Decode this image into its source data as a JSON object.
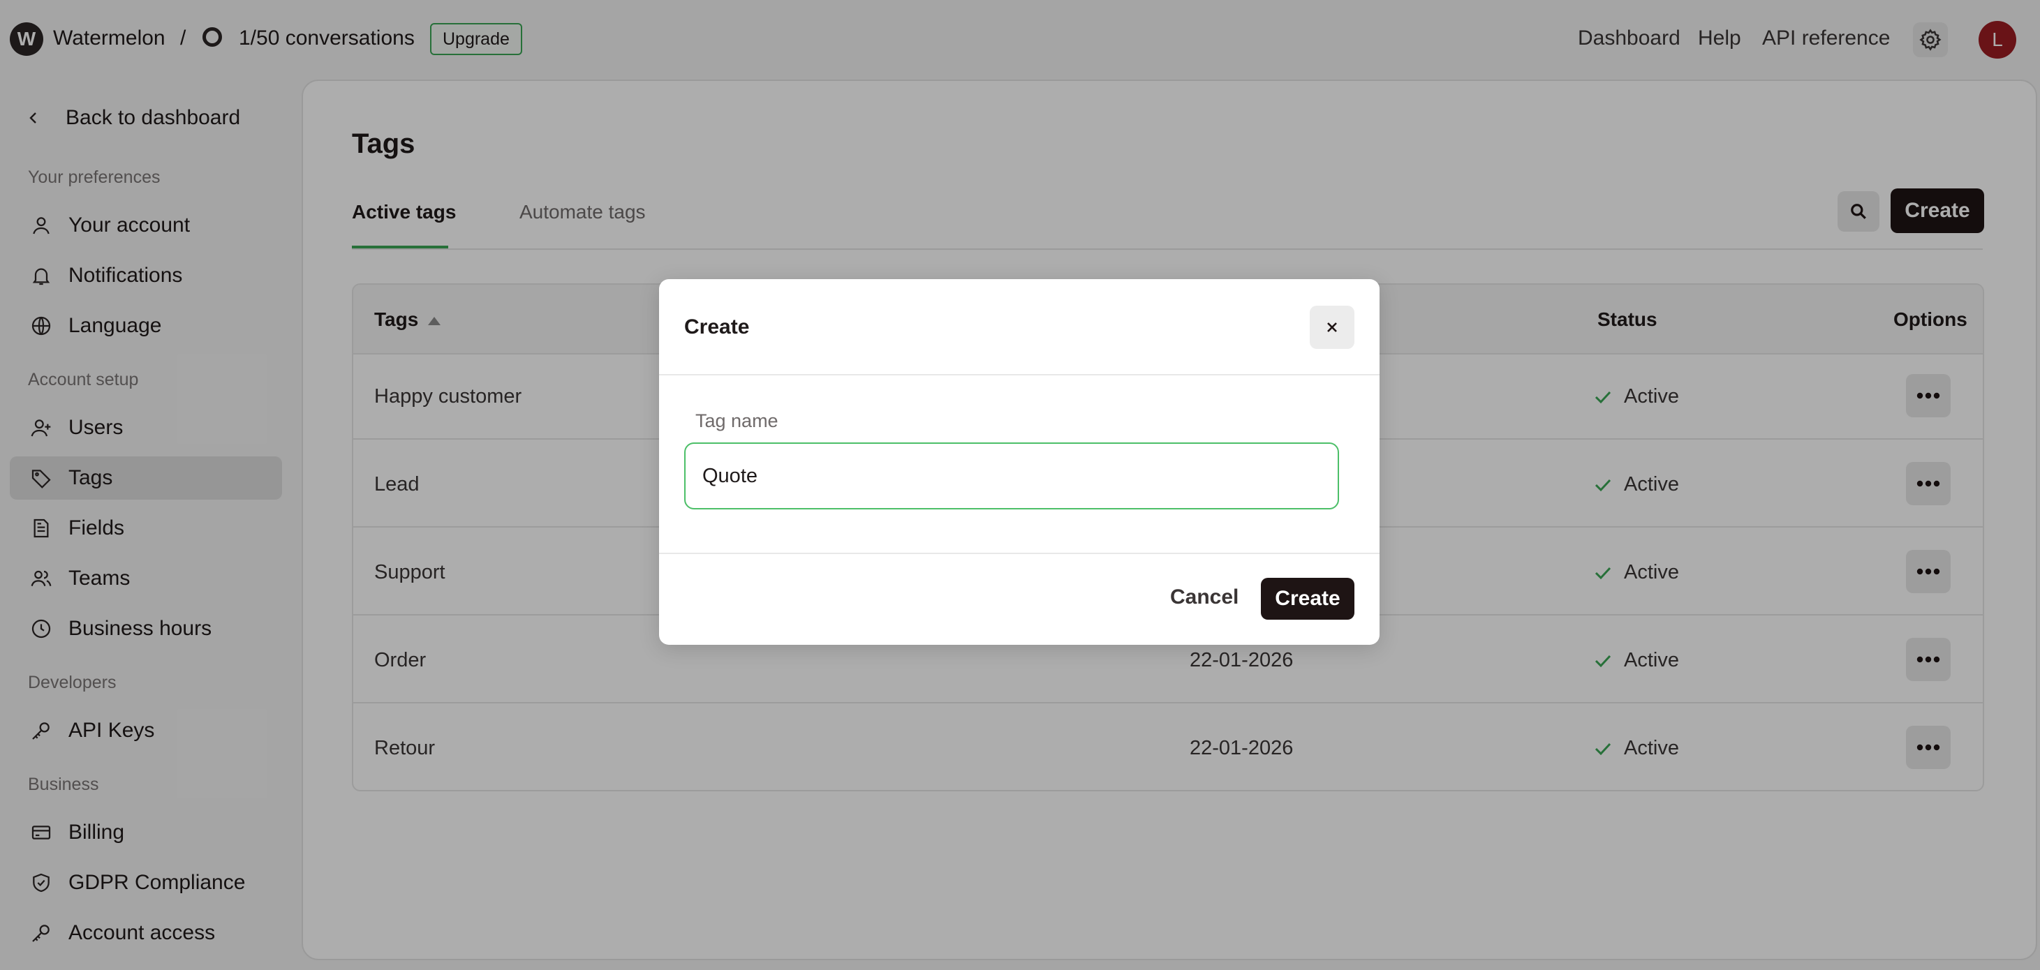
{
  "header": {
    "logo_letter": "W",
    "brand": "Watermelon",
    "separator": "/",
    "conversations": "1/50 conversations",
    "upgrade_label": "Upgrade",
    "links": [
      "Dashboard",
      "Help",
      "API reference"
    ],
    "avatar_initial": "L"
  },
  "sidebar": {
    "back_label": "Back to dashboard",
    "sections": {
      "preferences": "Your preferences",
      "account_setup": "Account setup",
      "developers": "Developers",
      "business": "Business"
    },
    "items": [
      {
        "label": "Your account",
        "icon": "user-icon"
      },
      {
        "label": "Notifications",
        "icon": "bell-icon"
      },
      {
        "label": "Language",
        "icon": "globe-icon"
      },
      {
        "label": "Users",
        "icon": "user-plus-icon"
      },
      {
        "label": "Tags",
        "icon": "tag-icon",
        "active": true
      },
      {
        "label": "Fields",
        "icon": "document-icon"
      },
      {
        "label": "Teams",
        "icon": "users-icon"
      },
      {
        "label": "Business hours",
        "icon": "clock-icon"
      },
      {
        "label": "API Keys",
        "icon": "key-icon"
      },
      {
        "label": "Billing",
        "icon": "credit-card-icon"
      },
      {
        "label": "GDPR Compliance",
        "icon": "shield-check-icon"
      },
      {
        "label": "Account access",
        "icon": "key-icon"
      }
    ]
  },
  "main": {
    "title": "Tags",
    "tabs": [
      {
        "label": "Active tags",
        "active": true
      },
      {
        "label": "Automate tags",
        "active": false
      }
    ],
    "create_label": "Create",
    "table": {
      "columns": {
        "tags": "Tags",
        "status": "Status",
        "options": "Options"
      },
      "rows": [
        {
          "name": "Happy customer",
          "date": "",
          "status": "Active"
        },
        {
          "name": "Lead",
          "date": "",
          "status": "Active"
        },
        {
          "name": "Support",
          "date": "",
          "status": "Active"
        },
        {
          "name": "Order",
          "date": "22-01-2026",
          "status": "Active"
        },
        {
          "name": "Retour",
          "date": "22-01-2026",
          "status": "Active"
        }
      ]
    }
  },
  "modal": {
    "title": "Create",
    "field_label": "Tag name",
    "field_value": "Quote",
    "cancel_label": "Cancel",
    "submit_label": "Create"
  },
  "colors": {
    "accent_green": "#3aa655",
    "primary_dark": "#1e1414",
    "avatar_red": "#9b1c22"
  }
}
